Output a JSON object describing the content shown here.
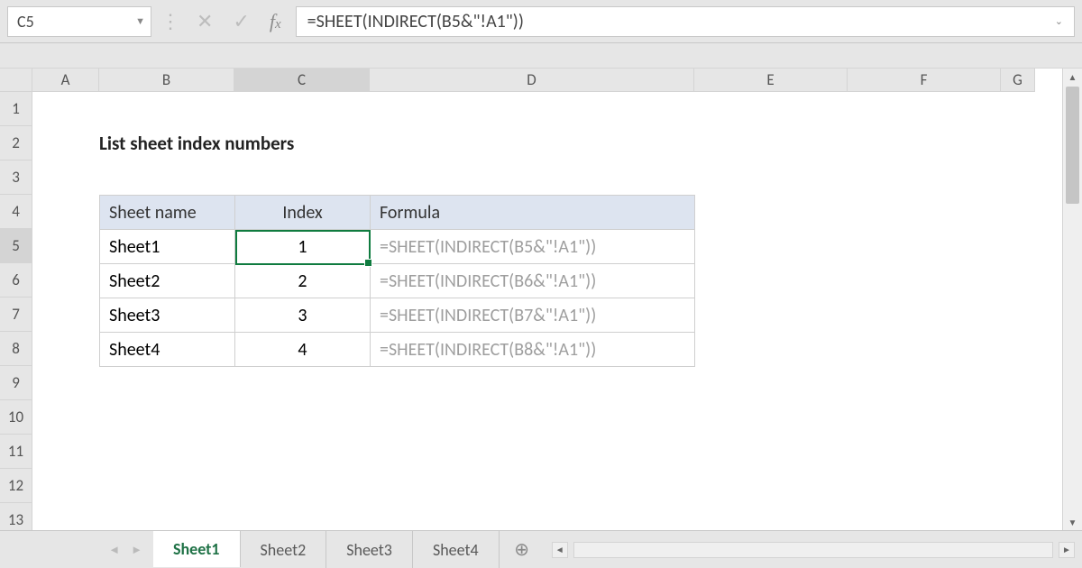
{
  "name_box": "C5",
  "formula_bar": "=SHEET(INDIRECT(B5&\"!A1\"))",
  "columns": [
    "A",
    "B",
    "C",
    "D",
    "E",
    "F",
    "G"
  ],
  "active_column": "C",
  "rows": [
    "1",
    "2",
    "3",
    "4",
    "5",
    "6",
    "7",
    "8",
    "9",
    "10",
    "11",
    "12",
    "13"
  ],
  "active_row": "5",
  "title": "List sheet index numbers",
  "table": {
    "headers": {
      "sheet": "Sheet name",
      "index": "Index",
      "formula": "Formula"
    },
    "rows": [
      {
        "sheet": "Sheet1",
        "index": "1",
        "formula": "=SHEET(INDIRECT(B5&\"!A1\"))"
      },
      {
        "sheet": "Sheet2",
        "index": "2",
        "formula": "=SHEET(INDIRECT(B6&\"!A1\"))"
      },
      {
        "sheet": "Sheet3",
        "index": "3",
        "formula": "=SHEET(INDIRECT(B7&\"!A1\"))"
      },
      {
        "sheet": "Sheet4",
        "index": "4",
        "formula": "=SHEET(INDIRECT(B8&\"!A1\"))"
      }
    ]
  },
  "sheet_tabs": [
    "Sheet1",
    "Sheet2",
    "Sheet3",
    "Sheet4"
  ],
  "active_tab": "Sheet1",
  "icons": {
    "plus": "⊕"
  }
}
